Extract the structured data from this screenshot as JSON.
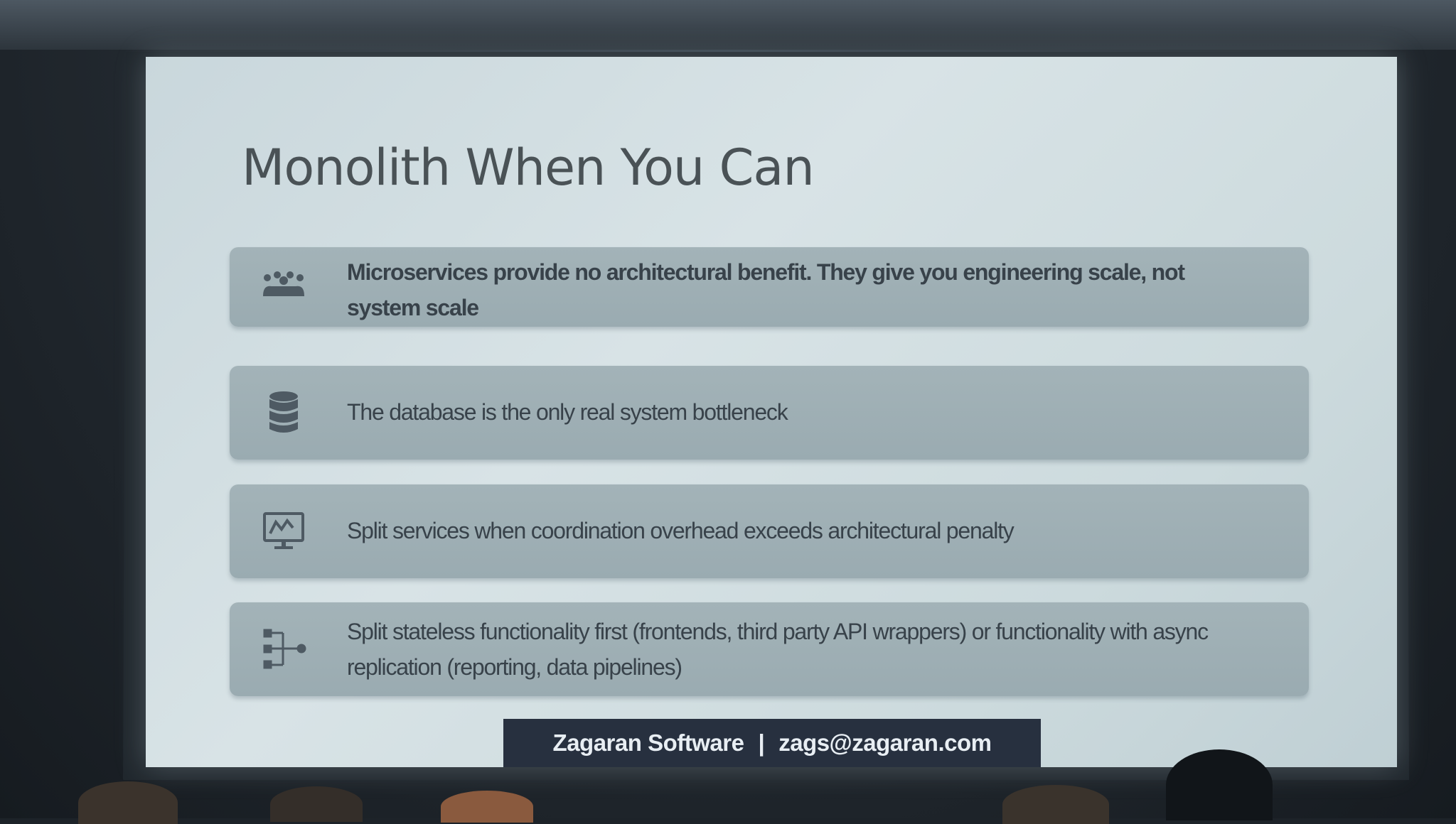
{
  "slide": {
    "title": "Monolith When You Can",
    "items": [
      {
        "icon": "people-group-icon",
        "text": "Microservices provide no architectural benefit.  They give you engineering scale, not system scale",
        "bold": true
      },
      {
        "icon": "database-icon",
        "text": "The database is the only real system bottleneck",
        "bold": false
      },
      {
        "icon": "monitor-diagram-icon",
        "text": "Split services when coordination overhead exceeds architectural penalty",
        "bold": false
      },
      {
        "icon": "flow-split-icon",
        "text": "Split stateless functionality first (frontends, third party API wrappers) or functionality with async replication (reporting, data pipelines)",
        "bold": false
      }
    ],
    "footer": {
      "company": "Zagaran Software",
      "separator": "|",
      "email": "zags@zagaran.com"
    }
  },
  "colors": {
    "slide_background": "#d4e0e3",
    "card_background": "#9fb0b5",
    "title_text": "#4a5256",
    "card_text": "#38424a",
    "footer_background": "#27303f",
    "footer_text": "#e8eef3"
  }
}
